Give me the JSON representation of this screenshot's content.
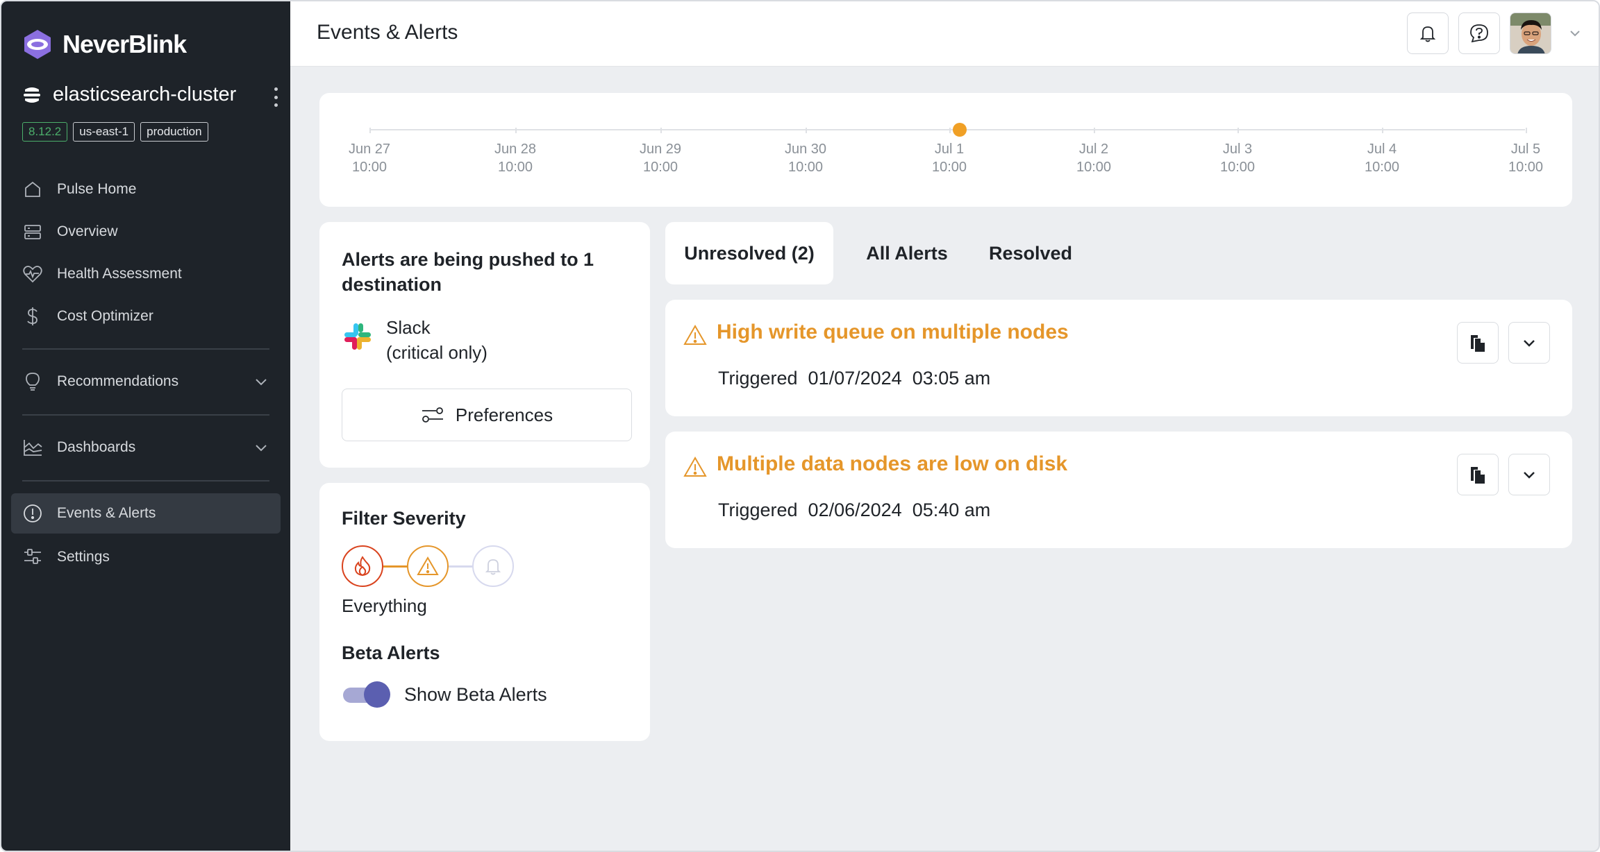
{
  "app": {
    "brand": "NeverBlink"
  },
  "cluster": {
    "name": "elasticsearch-cluster",
    "tags": [
      "8.12.2",
      "us-east-1",
      "production"
    ]
  },
  "sidebar": {
    "items": [
      {
        "label": "Pulse Home",
        "icon": "home-icon"
      },
      {
        "label": "Overview",
        "icon": "server-icon"
      },
      {
        "label": "Health Assessment",
        "icon": "heart-pulse-icon"
      },
      {
        "label": "Cost Optimizer",
        "icon": "dollar-icon"
      },
      {
        "label": "Recommendations",
        "icon": "lightbulb-icon"
      },
      {
        "label": "Dashboards",
        "icon": "chart-line-icon"
      },
      {
        "label": "Events & Alerts",
        "icon": "alert-circle-icon",
        "active": true
      },
      {
        "label": "Settings",
        "icon": "sliders-icon"
      }
    ]
  },
  "header": {
    "title": "Events & Alerts"
  },
  "timeline": {
    "ticks": [
      {
        "date": "Jun 27",
        "time": "10:00"
      },
      {
        "date": "Jun 28",
        "time": "10:00"
      },
      {
        "date": "Jun 29",
        "time": "10:00"
      },
      {
        "date": "Jun 30",
        "time": "10:00"
      },
      {
        "date": "Jul 1",
        "time": "10:00"
      },
      {
        "date": "Jul 2",
        "time": "10:00"
      },
      {
        "date": "Jul 3",
        "time": "10:00"
      },
      {
        "date": "Jul 4",
        "time": "10:00"
      },
      {
        "date": "Jul 5",
        "time": "10:00"
      }
    ],
    "marker_color": "#f0a026"
  },
  "destinations": {
    "title": "Alerts are being pushed to 1 destination",
    "name": "Slack",
    "detail": "(critical only)",
    "preferences_label": "Preferences"
  },
  "filter": {
    "title": "Filter Severity",
    "levels": [
      "critical",
      "warning",
      "info"
    ],
    "caption": "Everything",
    "beta_title": "Beta Alerts",
    "beta_toggle_label": "Show Beta Alerts",
    "beta_enabled": true
  },
  "tabs": [
    {
      "label": "Unresolved (2)",
      "active": true
    },
    {
      "label": "All Alerts"
    },
    {
      "label": "Resolved"
    }
  ],
  "alerts": [
    {
      "title": "High write queue on multiple nodes",
      "meta": "Triggered  01/07/2024  03:05 am"
    },
    {
      "title": "Multiple data nodes are low on disk",
      "meta": "Triggered  02/06/2024  05:40 am"
    }
  ],
  "colors": {
    "accent_warning": "#e5962a",
    "sidebar_bg": "#1e2329",
    "critical": "#d9431e",
    "toggle": "#5b5fb0"
  }
}
